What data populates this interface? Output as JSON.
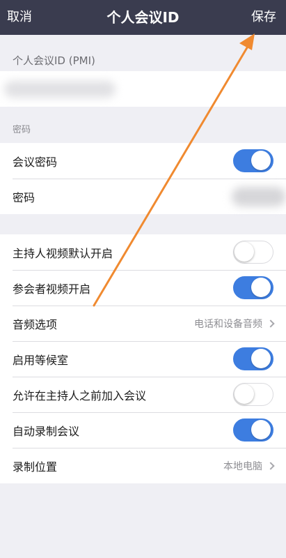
{
  "header": {
    "cancel_label": "取消",
    "title": "个人会议ID",
    "save_label": "保存"
  },
  "pmi_section": {
    "label": "个人会议ID (PMI)"
  },
  "password_section": {
    "label": "密码",
    "rows": [
      {
        "label": "会议密码",
        "toggle": true
      },
      {
        "label": "密码"
      }
    ]
  },
  "settings_section": {
    "rows": [
      {
        "label": "主持人视频默认开启",
        "toggle": false
      },
      {
        "label": "参会者视频开启",
        "toggle": true
      },
      {
        "label": "音频选项",
        "value": "电话和设备音频"
      },
      {
        "label": "启用等候室",
        "toggle": true
      },
      {
        "label": "允许在主持人之前加入会议",
        "toggle": false
      },
      {
        "label": "自动录制会议",
        "toggle": true
      },
      {
        "label": "录制位置",
        "value": "本地电脑"
      }
    ]
  },
  "colors": {
    "navbar": "#3a3c4f",
    "toggle_on": "#3d7de0",
    "annotation_arrow": "#f08a30",
    "background": "#efeff4"
  }
}
